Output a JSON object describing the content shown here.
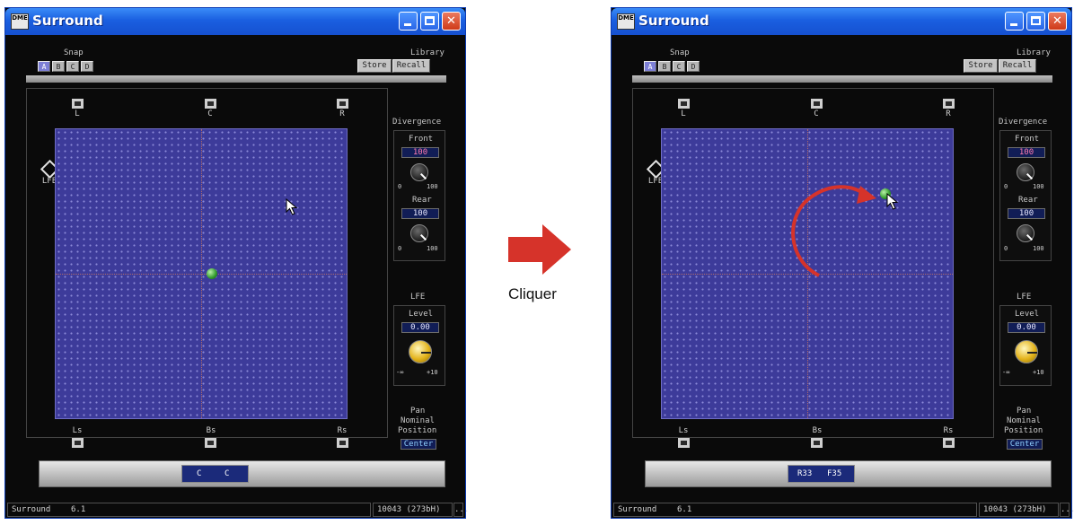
{
  "window": {
    "title": "Surround",
    "app_icon_text": "DME",
    "close_glyph": "✕"
  },
  "snap": {
    "label": "Snap",
    "buttons": [
      "A",
      "B",
      "C",
      "D"
    ],
    "selected": "A"
  },
  "library": {
    "label": "Library",
    "store": "Store",
    "recall": "Recall"
  },
  "speakers": {
    "front_left": "L",
    "center": "C",
    "front_right": "R",
    "surround_left": "Ls",
    "back_surround": "Bs",
    "surround_right": "Rs",
    "lfe": "LFE"
  },
  "divergence": {
    "label": "Divergence",
    "front_label": "Front",
    "front_value": "100",
    "rear_label": "Rear",
    "rear_value": "100",
    "knob_min": "0",
    "knob_max": "100"
  },
  "lfe_section": {
    "label": "LFE",
    "level_label": "Level",
    "level_value": "0.00",
    "knob_min": "-∞",
    "knob_max": "+10"
  },
  "pan": {
    "label_line1": "Pan",
    "label_line2": "Nominal",
    "label_line3": "Position",
    "value": "Center"
  },
  "before": {
    "position_x": "C",
    "position_y": "C"
  },
  "after": {
    "position_x": "R33",
    "position_y": "F35"
  },
  "status": {
    "mode_label": "Surround",
    "mode_value": "6.1",
    "id": "10043 (273bH)",
    "more": "..."
  },
  "transition": {
    "label": "Cliquer"
  },
  "colors": {
    "grid": "#3d3b9a",
    "accent_arrow": "#d6332a",
    "ball": "#3ea83a"
  }
}
